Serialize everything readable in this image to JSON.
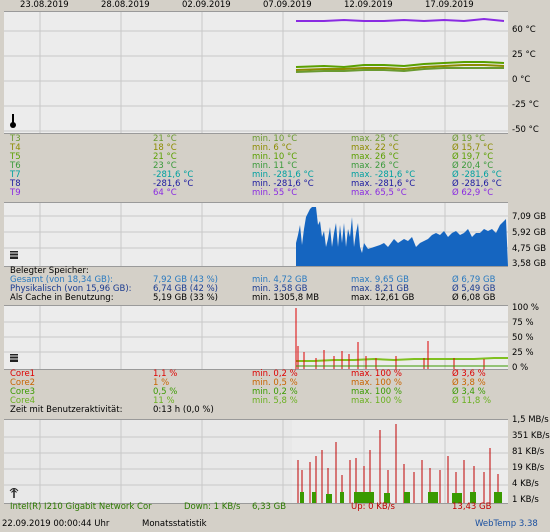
{
  "dates": [
    "23.08.2019",
    "28.08.2019",
    "02.09.2019",
    "07.09.2019",
    "12.09.2019",
    "17.09.2019"
  ],
  "colors": {
    "purple": "#8a2be2",
    "green": "#5aa000",
    "olive": "#8c8c00",
    "blue": "#1565c0",
    "cyan": "#00a0a0",
    "navy": "#1a1aa0",
    "red": "#dd0000",
    "orange": "#c86400",
    "cpu_green": "#3a9a00",
    "cpu_lightgreen": "#80c020"
  },
  "temp": {
    "axis": [
      "60 °C",
      "25 °C",
      "0 °C",
      "-25 °C",
      "-50 °C"
    ],
    "icon": "thermometer-icon",
    "rows": [
      {
        "name": "T3",
        "cur": "21 °C",
        "min": "min. 10 °C",
        "max": "max. 25 °C",
        "avg": "Ø 19 °C"
      },
      {
        "name": "T4",
        "cur": "18 °C",
        "min": "min. 6 °C",
        "max": "max. 22 °C",
        "avg": "Ø 15,7 °C"
      },
      {
        "name": "T5",
        "cur": "21 °C",
        "min": "min. 10 °C",
        "max": "max. 26 °C",
        "avg": "Ø 19,7 °C"
      },
      {
        "name": "T6",
        "cur": "23 °C",
        "min": "min. 11 °C",
        "max": "max. 26 °C",
        "avg": "Ø 20,4 °C"
      },
      {
        "name": "T7",
        "cur": "-281,6 °C",
        "min": "min. -281,6 °C",
        "max": "max. -281,6 °C",
        "avg": "Ø -281,6 °C"
      },
      {
        "name": "T8",
        "cur": "-281,6 °C",
        "min": "min. -281,6 °C",
        "max": "max. -281,6 °C",
        "avg": "Ø -281,6 °C"
      },
      {
        "name": "T9",
        "cur": "64 °C",
        "min": "min. 55 °C",
        "max": "max. 65,5 °C",
        "avg": "Ø 62,9 °C"
      }
    ]
  },
  "mem": {
    "axis": [
      "7,09 GB",
      "5,92 GB",
      "4,75 GB",
      "3,58 GB"
    ],
    "icon": "memory-chip-icon",
    "title": "Belegter Speicher:",
    "rows": [
      {
        "name": "Gesamt (von 18,34 GB):",
        "cur": "7,92 GB (43 %)",
        "min": "min. 4,72 GB",
        "max": "max. 9,65 GB",
        "avg": "Ø 6,79 GB"
      },
      {
        "name": "Physikalisch (von 15,96 GB):",
        "cur": "6,74 GB (42 %)",
        "min": "min. 3,58 GB",
        "max": "max. 8,21 GB",
        "avg": "Ø 5,49 GB"
      },
      {
        "name": "Als Cache in Benutzung:",
        "cur": "5,19 GB (33 %)",
        "min": "min. 1305,8 MB",
        "max": "max. 12,61 GB",
        "avg": "Ø 6,08 GB"
      }
    ]
  },
  "cpu": {
    "axis": [
      "100 %",
      "75 %",
      "50 %",
      "25 %",
      "0 %"
    ],
    "icon": "cpu-icon",
    "rows": [
      {
        "name": "Core1",
        "cur": "1,1 %",
        "min": "min. 0,2 %",
        "max": "max. 100 %",
        "avg": "Ø 3,6 %"
      },
      {
        "name": "Core2",
        "cur": "1 %",
        "min": "min. 0,5 %",
        "max": "max. 100 %",
        "avg": "Ø 3,8 %"
      },
      {
        "name": "Core3",
        "cur": "0,5 %",
        "min": "min. 0,2 %",
        "max": "max. 100 %",
        "avg": "Ø 3,4 %"
      },
      {
        "name": "Core4",
        "cur": "11 %",
        "min": "min. 5,8 %",
        "max": "max. 100 %",
        "avg": "Ø 11,8 %"
      }
    ],
    "activity_label": "Zeit mit Benutzeraktivität:",
    "activity_value": "0:13 h (0,0 %)"
  },
  "net": {
    "axis": [
      "1,5 MB/s",
      "351 KB/s",
      "81 KB/s",
      "19 KB/s",
      "4 KB/s",
      "1 KB/s"
    ],
    "icon": "network-icon",
    "adapter": "Intel(R) I210 Gigabit Network Cor",
    "down": "Down: 1 KB/s",
    "down_total": "6,33 GB",
    "up": "Up: 0 KB/s",
    "up_total": "13,43 GB"
  },
  "footer": {
    "datetime": "22.09.2019 00:00:44 Uhr",
    "stats": "Monatsstatistik",
    "brand": "WebTemp 3.38"
  }
}
